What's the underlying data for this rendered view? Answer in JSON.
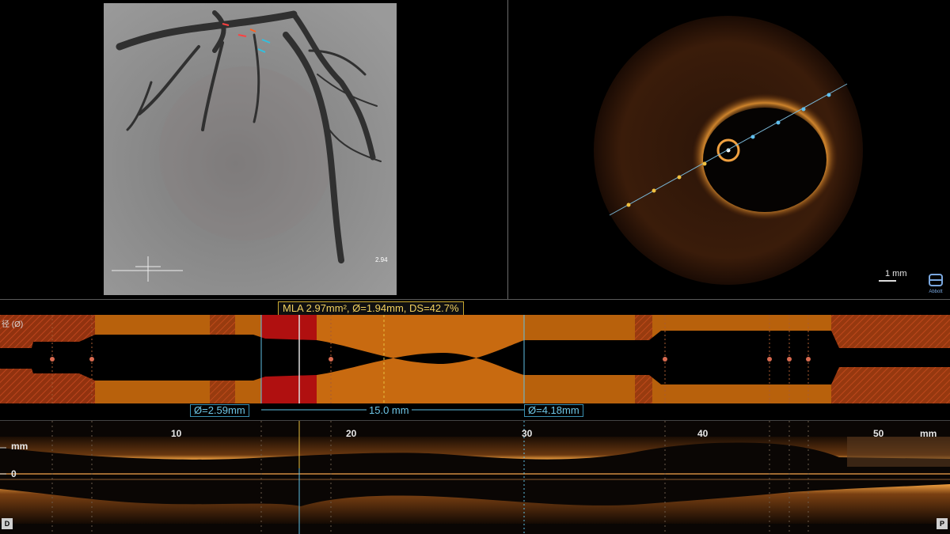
{
  "angiogram": {
    "scale_note": "2.94"
  },
  "oct_cross_section": {
    "scale_label": "1 mm",
    "brand": "Abbott"
  },
  "lumen_profile": {
    "axis_tag": "径 (Ø)",
    "mla_label": "MLA 2.97mm², Ø=1.94mm, DS=42.7%",
    "proximal_ref": "Ø=2.59mm",
    "length": "15.0 mm",
    "distal_ref": "Ø=4.18mm"
  },
  "longitudinal_view": {
    "ticks": [
      "10",
      "20",
      "30",
      "40",
      "50"
    ],
    "unit": "mm",
    "y_unit": "mm",
    "zero_label": "0",
    "distal_button": "D",
    "proximal_button": "P"
  },
  "colors": {
    "accent_orange": "#c86a10",
    "lesion_red": "#a81010",
    "measure_cyan": "#5fc0e4",
    "label_gold": "#e8c040"
  }
}
